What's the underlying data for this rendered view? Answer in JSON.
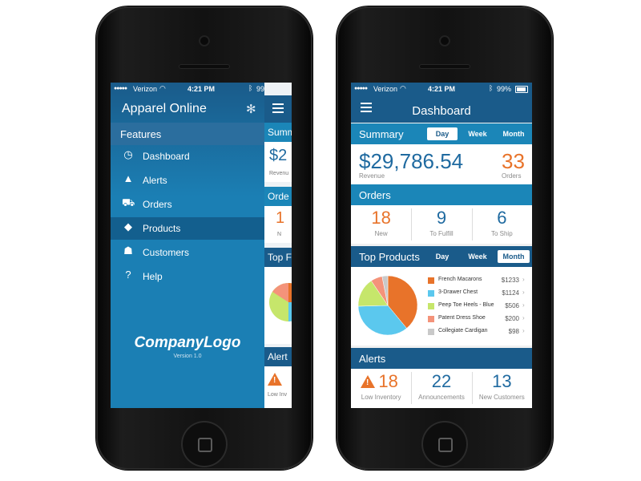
{
  "status_bar": {
    "carrier": "Verizon",
    "time": "4:21 PM",
    "battery": "99%"
  },
  "menu": {
    "app_title": "Apparel Online",
    "section_label": "Features",
    "items": [
      {
        "label": "Dashboard",
        "icon": "dashboard-icon",
        "active": false
      },
      {
        "label": "Alerts",
        "icon": "alert-icon",
        "active": false
      },
      {
        "label": "Orders",
        "icon": "cart-icon",
        "active": false
      },
      {
        "label": "Products",
        "icon": "tag-icon",
        "active": true
      },
      {
        "label": "Customers",
        "icon": "customers-icon",
        "active": false
      },
      {
        "label": "Help",
        "icon": "help-icon",
        "active": false
      }
    ],
    "logo_text": "CompanyLogo",
    "version": "Version 1.0"
  },
  "peek": {
    "summary": "Summ",
    "revenue_fragment": "$2",
    "revenue_caption": "Revenu",
    "orders": "Orde",
    "orders_value": "1",
    "orders_caption": "N",
    "top_products": "Top F",
    "alerts": "Alert",
    "alerts_caption": "Low Inv"
  },
  "dashboard": {
    "title": "Dashboard",
    "summary": {
      "title": "Summary",
      "tabs": [
        "Day",
        "Week",
        "Month"
      ],
      "active_tab": "Day",
      "revenue": "$29,786.54",
      "revenue_label": "Revenue",
      "orders": "33",
      "orders_label": "Orders"
    },
    "orders_section": {
      "title": "Orders",
      "cells": [
        {
          "value": "18",
          "label": "New",
          "color": "#e8732a"
        },
        {
          "value": "9",
          "label": "To Fulfill",
          "color": "#1f6aa0"
        },
        {
          "value": "6",
          "label": "To Ship",
          "color": "#1f6aa0"
        }
      ]
    },
    "top_products": {
      "title": "Top Products",
      "tabs": [
        "Day",
        "Week",
        "Month"
      ],
      "active_tab": "Month",
      "items": [
        {
          "name": "French Macarons",
          "value": "$1233",
          "amount": 1233,
          "color": "#e8732a"
        },
        {
          "name": "3-Drawer Chest",
          "value": "$1124",
          "amount": 1124,
          "color": "#5bc8ee"
        },
        {
          "name": "Peep Toe Heels - Blue",
          "value": "$506",
          "amount": 506,
          "color": "#c6e66b"
        },
        {
          "name": "Patent Dress Shoe",
          "value": "$200",
          "amount": 200,
          "color": "#f4937a"
        },
        {
          "name": "Collegiate Cardigan",
          "value": "$98",
          "amount": 98,
          "color": "#c9c9c9"
        }
      ]
    },
    "alerts": {
      "title": "Alerts",
      "cells": [
        {
          "value": "18",
          "label": "Low Inventory",
          "color": "#e8732a"
        },
        {
          "value": "22",
          "label": "Announcements",
          "color": "#1f6aa0"
        },
        {
          "value": "13",
          "label": "New Customers",
          "color": "#1f6aa0"
        }
      ]
    }
  }
}
